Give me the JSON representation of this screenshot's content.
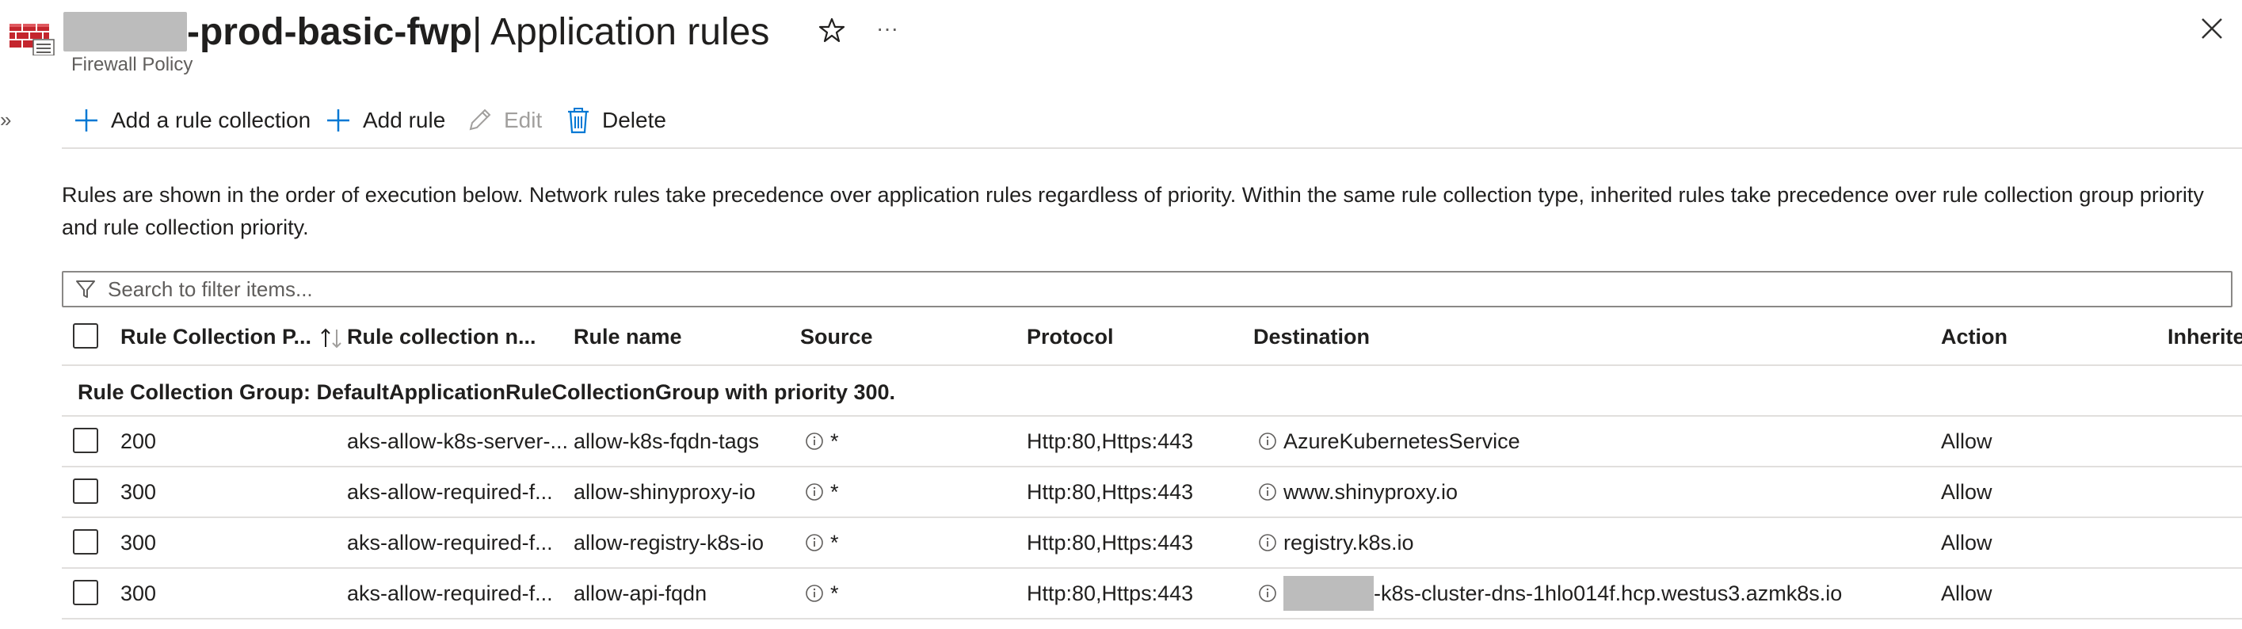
{
  "header": {
    "title_bold": "-prod-basic-fwp",
    "title_rest": " | Application rules",
    "subtitle": "Firewall Policy",
    "more_label": "···",
    "collapse_label": "»"
  },
  "toolbar": {
    "add_collection": "Add a rule collection",
    "add_rule": "Add rule",
    "edit": "Edit",
    "delete": "Delete"
  },
  "description": "Rules are shown in the order of execution below. Network rules take precedence over application rules regardless of priority. Within the same rule collection type, inherited rules take precedence over rule collection group priority and rule collection priority.",
  "search": {
    "placeholder": "Search to filter items..."
  },
  "columns": {
    "priority": "Rule Collection P...",
    "collection": "Rule collection n...",
    "rule_name": "Rule name",
    "source": "Source",
    "protocol": "Protocol",
    "destination": "Destination",
    "action": "Action",
    "inherited": "Inherite"
  },
  "group_label": "Rule Collection Group: DefaultApplicationRuleCollectionGroup with priority 300.",
  "rows": [
    {
      "priority": "200",
      "collection": "aks-allow-k8s-server-...",
      "rule_name": "allow-k8s-fqdn-tags",
      "source": "*",
      "protocol": "Http:80,Https:443",
      "destination": "AzureKubernetesService",
      "action": "Allow"
    },
    {
      "priority": "300",
      "collection": "aks-allow-required-f...",
      "rule_name": "allow-shinyproxy-io",
      "source": "*",
      "protocol": "Http:80,Https:443",
      "destination": "www.shinyproxy.io",
      "action": "Allow"
    },
    {
      "priority": "300",
      "collection": "aks-allow-required-f...",
      "rule_name": "allow-registry-k8s-io",
      "source": "*",
      "protocol": "Http:80,Https:443",
      "destination": "registry.k8s.io",
      "action": "Allow"
    },
    {
      "priority": "300",
      "collection": "aks-allow-required-f...",
      "rule_name": "allow-api-fqdn",
      "source": "*",
      "protocol": "Http:80,Https:443",
      "destination": "-k8s-cluster-dns-1hlo014f.hcp.westus3.azmk8s.io",
      "action": "Allow"
    }
  ],
  "colors": {
    "accent": "#0078d4",
    "brand_red": "#c4262e",
    "text": "#201f1e",
    "muted": "#605e5c",
    "disabled": "#a19f9d",
    "divider": "#e1dfdd"
  }
}
